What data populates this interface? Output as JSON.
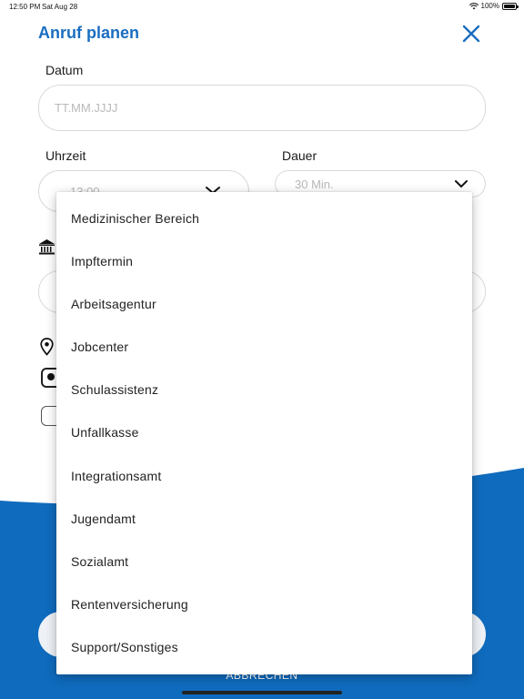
{
  "status_bar": {
    "time": "12:50 PM",
    "date": "Sat Aug 28",
    "battery": "100%"
  },
  "header": {
    "title": "Anruf planen",
    "close_icon": "close-icon"
  },
  "form": {
    "date_label": "Datum",
    "date_placeholder": "TT.MM.JJJJ",
    "time_label": "Uhrzeit",
    "time_value": "13:00",
    "duration_label": "Dauer",
    "duration_value": "30 Min.",
    "institution_icon": "bank-icon",
    "location_icon": "location-pin-icon"
  },
  "dropdown": {
    "options": [
      "Medizinischer Bereich",
      "Impftermin",
      "Arbeitsagentur",
      "Jobcenter",
      "Schulassistenz",
      "Unfallkasse",
      "Integrationsamt",
      "Jugendamt",
      "Sozialamt",
      "Rentenversicherung",
      "Support/Sonstiges"
    ]
  },
  "footer": {
    "cancel_label": "ABBRECHEN"
  },
  "colors": {
    "accent": "#1a6dc0",
    "wave": "#0f6bbd"
  }
}
